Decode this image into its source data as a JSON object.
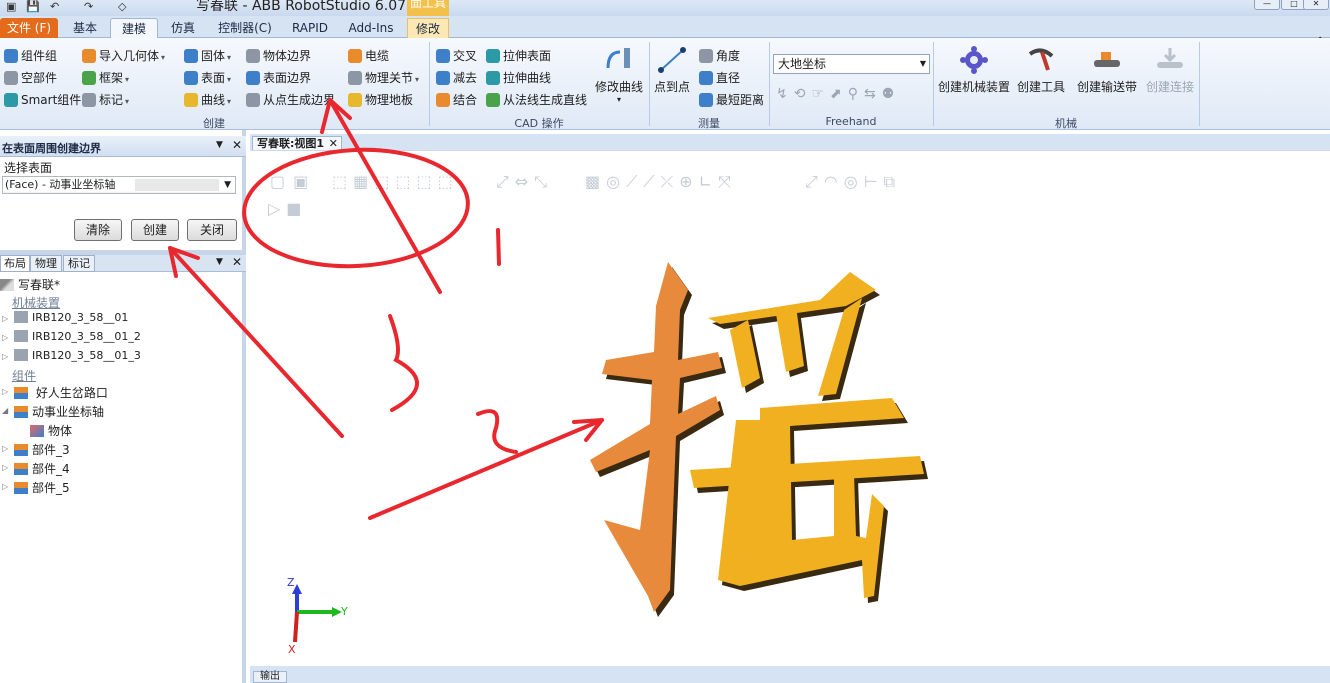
{
  "window": {
    "title": "写春联 - ABB RobotStudio 6.07",
    "context_tab_label": "面工具"
  },
  "tabs": [
    {
      "label": "文件 (F)"
    },
    {
      "label": "基本"
    },
    {
      "label": "建模"
    },
    {
      "label": "仿真"
    },
    {
      "label": "控制器(C)"
    },
    {
      "label": "RAPID"
    },
    {
      "label": "Add-Ins"
    },
    {
      "label": "修改"
    }
  ],
  "ribbon": {
    "create": {
      "label": "创建",
      "items": {
        "component_group": "组件组",
        "empty_part": "空部件",
        "smart_component": "Smart组件",
        "import_geometry": "导入几何体",
        "frame": "框架",
        "marker": "标记",
        "solid": "固体",
        "surface": "表面",
        "curve": "曲线",
        "body_edge": "物体边界",
        "surface_edge": "表面边界",
        "edge_from_point": "从点生成边界",
        "cable": "电缆",
        "physics_joint": "物理关节",
        "physics_floor": "物理地板"
      }
    },
    "cad": {
      "label": "CAD 操作",
      "items": {
        "intersect": "交叉",
        "subtract": "减去",
        "union": "结合",
        "extrude_surface": "拉伸表面",
        "extrude_curve": "拉伸曲线",
        "normal_line": "从法线生成直线",
        "modify_curve": "修改曲线"
      }
    },
    "measure": {
      "label": "测量",
      "items": {
        "point_to_point": "点到点",
        "angle": "角度",
        "diameter": "直径",
        "shortest_distance": "最短距离"
      }
    },
    "freehand": {
      "label": "Freehand",
      "coordinate": "大地坐标"
    },
    "mechanism": {
      "label": "机械",
      "items": {
        "create_mechanism": "创建机械装置",
        "create_tool": "创建工具",
        "create_conveyor": "创建输送带",
        "create_connection": "创建连接"
      }
    }
  },
  "surface_panel": {
    "title": "在表面周围创建边界",
    "select_label": "选择表面",
    "selected_value": "(Face) - 动事业坐标轴",
    "buttons": {
      "clear": "清除",
      "create": "创建",
      "close": "关闭"
    }
  },
  "layout_panel": {
    "tabs": [
      "布局",
      "物理",
      "标记"
    ],
    "root": "写春联*",
    "category_mechanisms": "机械装置",
    "mechanisms": [
      "IRB120_3_58__01",
      "IRB120_3_58__01_2",
      "IRB120_3_58__01_3"
    ],
    "category_components": "组件",
    "components": [
      "好人生岔路口",
      "动事业坐标轴"
    ],
    "child": "物体",
    "parts": [
      "部件_3",
      "部件_4",
      "部件_5"
    ]
  },
  "viewport": {
    "tab_label": "写春联:视图1",
    "character": "摇",
    "axis": {
      "x": "X",
      "y": "Y",
      "z": "Z"
    }
  },
  "annotations": {
    "num1": "1",
    "num2": "2",
    "num3": "3"
  },
  "output_tab": "输出",
  "colors": {
    "file_tab": "#e46a1c",
    "char_light": "#f0b020",
    "char_dark": "#e88a3c",
    "annotation_red": "#e8282e"
  }
}
